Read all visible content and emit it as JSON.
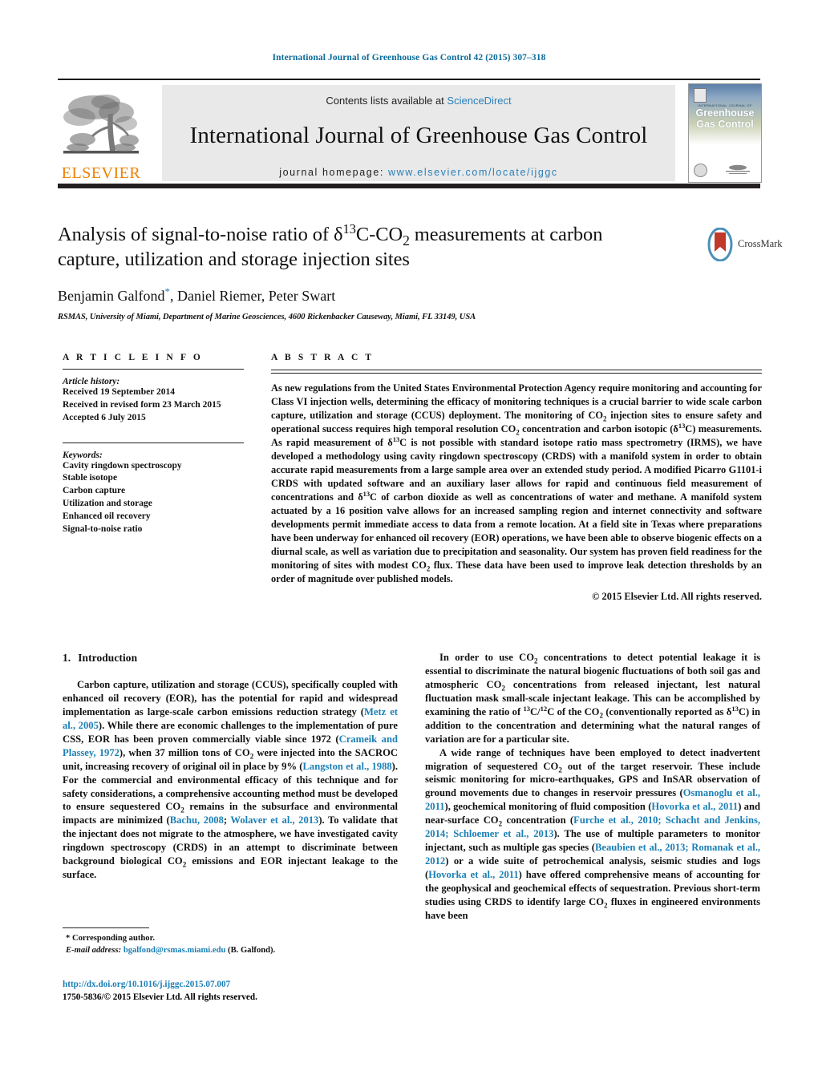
{
  "running_head": "International Journal of Greenhouse Gas Control 42 (2015) 307–318",
  "masthead": {
    "publisher_wordmark": "ELSEVIER",
    "contents_label": "Contents lists available at",
    "contents_link": "ScienceDirect",
    "journal_title": "International Journal of Greenhouse Gas Control",
    "homepage_label": "journal homepage:",
    "homepage_url": "www.elsevier.com/locate/ijggc",
    "cover": {
      "kicker": "INTERNATIONAL JOURNAL OF",
      "title_line1": "Greenhouse",
      "title_line2": "Gas Control",
      "publisher_mark": "ELSEVIER"
    }
  },
  "article": {
    "title_line1": "Analysis of signal-to-noise ratio of δ13C-CO2 measurements at carbon",
    "title_line2": "capture, utilization and storage injection sites",
    "authors": "Benjamin Galfond, Daniel Riemer, Peter Swart",
    "corresponding_marker": "*",
    "affiliation": "RSMAS, University of Miami, Department of Marine Geosciences, 4600 Rickenbacker Causeway, Miami, FL 33149, USA",
    "crossmark_label": "CrossMark"
  },
  "article_info": {
    "heading": "A R T I C L E   I N F O",
    "history_label": "Article history:",
    "history": [
      "Received 19 September 2014",
      "Received in revised form 23 March 2015",
      "Accepted 6 July 2015"
    ],
    "keywords_label": "Keywords:",
    "keywords": [
      "Cavity ringdown spectroscopy",
      "Stable isotope",
      "Carbon capture",
      "Utilization and storage",
      "Enhanced oil recovery",
      "Signal-to-noise ratio"
    ]
  },
  "abstract": {
    "heading": "A B S T R A C T",
    "body": "As new regulations from the United States Environmental Protection Agency require monitoring and accounting for Class VI injection wells, determining the efficacy of monitoring techniques is a crucial barrier to wide scale carbon capture, utilization and storage (CCUS) deployment. The monitoring of CO2 injection sites to ensure safety and operational success requires high temporal resolution CO2 concentration and carbon isotopic (δ13C) measurements. As rapid measurement of δ13C is not possible with standard isotope ratio mass spectrometry (IRMS), we have developed a methodology using cavity ringdown spectroscopy (CRDS) with a manifold system in order to obtain accurate rapid measurements from a large sample area over an extended study period. A modified Picarro G1101-i CRDS with updated software and an auxiliary laser allows for rapid and continuous field measurement of concentrations and δ13C of carbon dioxide as well as concentrations of water and methane. A manifold system actuated by a 16 position valve allows for an increased sampling region and internet connectivity and software developments permit immediate access to data from a remote location. At a field site in Texas where preparations have been underway for enhanced oil recovery (EOR) operations, we have been able to observe biogenic effects on a diurnal scale, as well as variation due to precipitation and seasonality. Our system has proven field readiness for the monitoring of sites with modest CO2 flux. These data have been used to improve leak detection thresholds by an order of magnitude over published models.",
    "copyright": "© 2015 Elsevier Ltd. All rights reserved."
  },
  "introduction": {
    "number": "1.",
    "heading": "Introduction",
    "left_paragraph": "Carbon capture, utilization and storage (CCUS), specifically coupled with enhanced oil recovery (EOR), has the potential for rapid and widespread implementation as large-scale carbon emissions reduction strategy (Metz et al., 2005). While there are economic challenges to the implementation of pure CSS, EOR has been proven commercially viable since 1972 (Crameik and Plassey, 1972), when 37 million tons of CO2 were injected into the SACROC unit, increasing recovery of original oil in place by 9% (Langston et al., 1988). For the commercial and environmental efficacy of this technique and for safety considerations, a comprehensive accounting method must be developed to ensure sequestered CO2 remains in the subsurface and environmental impacts are minimized (Bachu, 2008; Wolaver et al., 2013). To validate that the injectant does not migrate to the atmosphere, we have investigated cavity ringdown spectroscopy (CRDS) in an attempt to discriminate between background biological CO2 emissions and EOR injectant leakage to the surface.",
    "right_paragraph_1": "In order to use CO2 concentrations to detect potential leakage it is essential to discriminate the natural biogenic fluctuations of both soil gas and atmospheric CO2 concentrations from released injectant, lest natural fluctuation mask small-scale injectant leakage. This can be accomplished by examining the ratio of 13C/12C of the CO2 (conventionally reported as δ13C) in addition to the concentration and determining what the natural ranges of variation are for a particular site.",
    "right_paragraph_2": "A wide range of techniques have been employed to detect inadvertent migration of sequestered CO2 out of the target reservoir. These include seismic monitoring for micro-earthquakes, GPS and InSAR observation of ground movements due to changes in reservoir pressures (Osmanoglu et al., 2011), geochemical monitoring of fluid composition (Hovorka et al., 2011) and near-surface CO2 concentration (Furche et al., 2010; Schacht and Jenkins, 2014; Schloemer et al., 2013). The use of multiple parameters to monitor injectant, such as multiple gas species (Beaubien et al., 2013; Romanak et al., 2012) or a wide suite of petrochemical analysis, seismic studies and logs (Hovorka et al., 2011) have offered comprehensive means of accounting for the geophysical and geochemical effects of sequestration. Previous short-term studies using CRDS to identify large CO2 fluxes in engineered environments have been",
    "references": [
      "Metz et al., 2005",
      "Crameik and Plassey, 1972",
      "Langston et al., 1988",
      "Bachu, 2008",
      "Wolaver et al., 2013",
      "Osmanoglu et al., 2011",
      "Hovorka et al., 2011",
      "Furche et al., 2010; Schacht and Jenkins, 2014",
      "Schloemer et al., 2013",
      "Beaubien et al., 2013",
      "Romanak et al., 2012",
      "Hovorka et al., 2011"
    ]
  },
  "footer": {
    "corresponding_author": "* Corresponding author.",
    "email_label": "E-mail address:",
    "email": "bgalfond@rsmas.miami.edu",
    "email_attribution": "(B. Galfond).",
    "doi_url": "http://dx.doi.org/10.1016/j.ijggc.2015.07.007",
    "issn_line": "1750-5836/© 2015 Elsevier Ltd. All rights reserved."
  },
  "colors": {
    "link": "#1b7fb5",
    "elsevier_orange": "#f08000",
    "rule": "#231f20"
  }
}
